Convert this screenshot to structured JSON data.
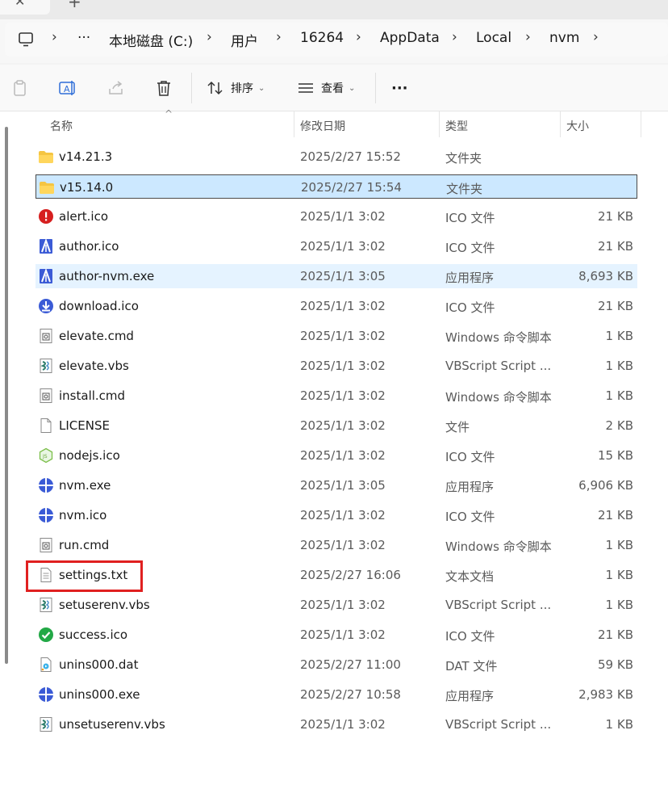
{
  "address": {
    "breadcrumbs": [
      "本地磁盘 (C:)",
      "用户",
      "16264",
      "AppData",
      "Local",
      "nvm"
    ],
    "more_label": "···",
    "separator": "›"
  },
  "toolbar": {
    "sort_label": "排序",
    "view_label": "查看",
    "more_label": "···"
  },
  "columns": {
    "name": "名称",
    "modified": "修改日期",
    "type": "类型",
    "size": "大小"
  },
  "files": [
    {
      "name": "v14.21.3",
      "modified": "2025/2/27 15:52",
      "type": "文件夹",
      "size": "",
      "icon": "folder-icon",
      "state": "normal"
    },
    {
      "name": "v15.14.0",
      "modified": "2025/2/27 15:54",
      "type": "文件夹",
      "size": "",
      "icon": "folder-icon",
      "state": "selected"
    },
    {
      "name": "alert.ico",
      "modified": "2025/1/1 3:02",
      "type": "ICO 文件",
      "size": "21 KB",
      "icon": "alert-icon",
      "state": "normal"
    },
    {
      "name": "author.ico",
      "modified": "2025/1/1 3:02",
      "type": "ICO 文件",
      "size": "21 KB",
      "icon": "author-icon",
      "state": "normal"
    },
    {
      "name": "author-nvm.exe",
      "modified": "2025/1/1 3:05",
      "type": "应用程序",
      "size": "8,693 KB",
      "icon": "author-icon",
      "state": "hover"
    },
    {
      "name": "download.ico",
      "modified": "2025/1/1 3:02",
      "type": "ICO 文件",
      "size": "21 KB",
      "icon": "download-icon",
      "state": "normal"
    },
    {
      "name": "elevate.cmd",
      "modified": "2025/1/1 3:02",
      "type": "Windows 命令脚本",
      "size": "1 KB",
      "icon": "cmd-icon",
      "state": "normal"
    },
    {
      "name": "elevate.vbs",
      "modified": "2025/1/1 3:02",
      "type": "VBScript Script ...",
      "size": "1 KB",
      "icon": "vbs-icon",
      "state": "normal"
    },
    {
      "name": "install.cmd",
      "modified": "2025/1/1 3:02",
      "type": "Windows 命令脚本",
      "size": "1 KB",
      "icon": "cmd-icon",
      "state": "normal"
    },
    {
      "name": "LICENSE",
      "modified": "2025/1/1 3:02",
      "type": "文件",
      "size": "2 KB",
      "icon": "blank-file-icon",
      "state": "normal"
    },
    {
      "name": "nodejs.ico",
      "modified": "2025/1/1 3:02",
      "type": "ICO 文件",
      "size": "15 KB",
      "icon": "nodejs-icon",
      "state": "normal"
    },
    {
      "name": "nvm.exe",
      "modified": "2025/1/1 3:05",
      "type": "应用程序",
      "size": "6,906 KB",
      "icon": "nvm-icon",
      "state": "normal"
    },
    {
      "name": "nvm.ico",
      "modified": "2025/1/1 3:02",
      "type": "ICO 文件",
      "size": "21 KB",
      "icon": "nvm-icon",
      "state": "normal"
    },
    {
      "name": "run.cmd",
      "modified": "2025/1/1 3:02",
      "type": "Windows 命令脚本",
      "size": "1 KB",
      "icon": "cmd-icon",
      "state": "normal"
    },
    {
      "name": "settings.txt",
      "modified": "2025/2/27 16:06",
      "type": "文本文档",
      "size": "1 KB",
      "icon": "text-file-icon",
      "state": "annotated"
    },
    {
      "name": "setuserenv.vbs",
      "modified": "2025/1/1 3:02",
      "type": "VBScript Script ...",
      "size": "1 KB",
      "icon": "vbs-icon",
      "state": "normal"
    },
    {
      "name": "success.ico",
      "modified": "2025/1/1 3:02",
      "type": "ICO 文件",
      "size": "21 KB",
      "icon": "success-icon",
      "state": "normal"
    },
    {
      "name": "unins000.dat",
      "modified": "2025/2/27 11:00",
      "type": "DAT 文件",
      "size": "59 KB",
      "icon": "dat-icon",
      "state": "normal"
    },
    {
      "name": "unins000.exe",
      "modified": "2025/2/27 10:58",
      "type": "应用程序",
      "size": "2,983 KB",
      "icon": "nvm-icon",
      "state": "normal"
    },
    {
      "name": "unsetuserenv.vbs",
      "modified": "2025/1/1 3:02",
      "type": "VBScript Script ...",
      "size": "1 KB",
      "icon": "vbs-icon",
      "state": "normal"
    }
  ],
  "colors": {
    "selection": "#cce8ff",
    "hover": "#e5f3ff",
    "annotation": "#e02020",
    "folder": "#f5c542",
    "alert": "#d61f1f",
    "success": "#22a846",
    "accent": "#3b5bd6"
  }
}
